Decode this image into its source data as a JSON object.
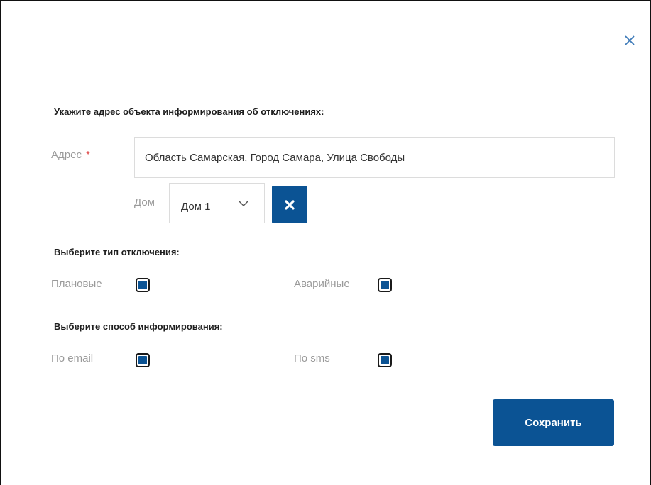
{
  "dialog": {
    "close_icon": "close-icon"
  },
  "address_section": {
    "title": "Укажите адрес объекта информирования об отключениях:",
    "address_label": "Адрес",
    "required_mark": "*",
    "address_value": "Область Самарская, Город Самара, Улица Свободы",
    "house_label": "Дом",
    "house_value": "Дом 1",
    "clear_icon": "close-x-icon"
  },
  "outage_type": {
    "title": "Выберите тип отключения:",
    "options": [
      {
        "label": "Плановые",
        "checked": true
      },
      {
        "label": "Аварийные",
        "checked": true
      }
    ]
  },
  "notify_method": {
    "title": "Выберите способ информирования:",
    "options": [
      {
        "label": "По email",
        "checked": true
      },
      {
        "label": "По sms",
        "checked": true
      }
    ]
  },
  "actions": {
    "save_label": "Сохранить"
  },
  "colors": {
    "accent": "#0b5394",
    "required": "#e05050",
    "label_gray": "#9a9a9a"
  }
}
